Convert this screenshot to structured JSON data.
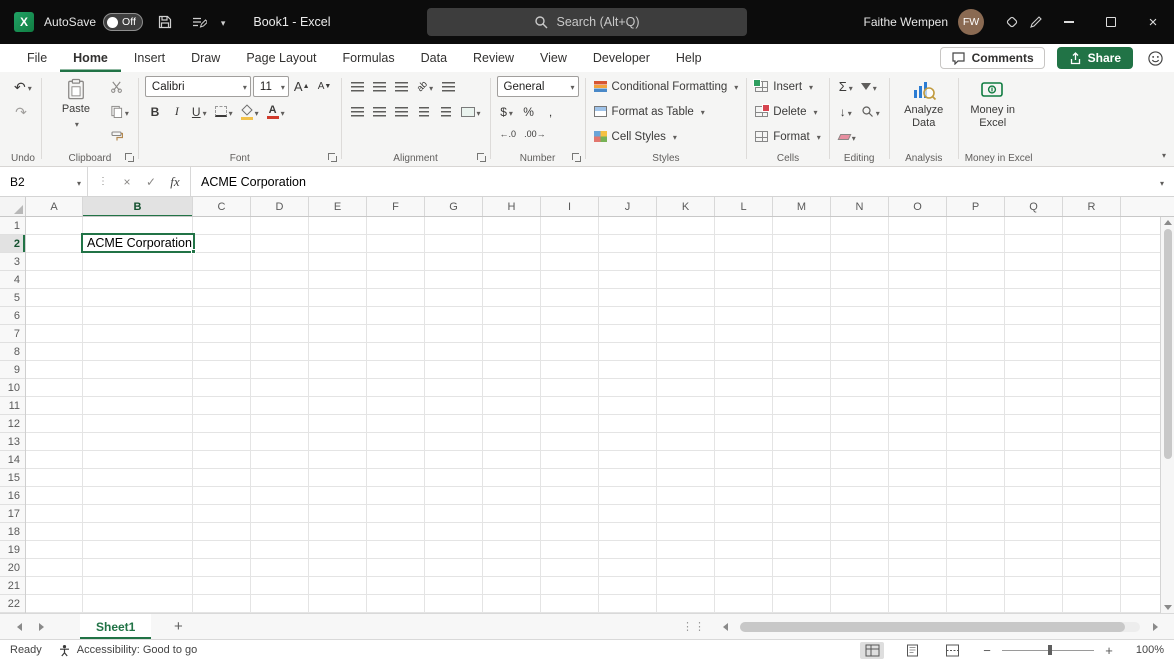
{
  "titlebar": {
    "autosave_label": "AutoSave",
    "autosave_state": "Off",
    "window_title": "Book1 - Excel",
    "search_placeholder": "Search (Alt+Q)",
    "user_name": "Faithe Wempen",
    "user_initials": "FW"
  },
  "tabs": [
    {
      "label": "File",
      "active": false
    },
    {
      "label": "Home",
      "active": true
    },
    {
      "label": "Insert",
      "active": false
    },
    {
      "label": "Draw",
      "active": false
    },
    {
      "label": "Page Layout",
      "active": false
    },
    {
      "label": "Formulas",
      "active": false
    },
    {
      "label": "Data",
      "active": false
    },
    {
      "label": "Review",
      "active": false
    },
    {
      "label": "View",
      "active": false
    },
    {
      "label": "Developer",
      "active": false
    },
    {
      "label": "Help",
      "active": false
    }
  ],
  "tab_actions": {
    "comments_label": "Comments",
    "share_label": "Share"
  },
  "ribbon": {
    "group_labels": [
      "Undo",
      "Clipboard",
      "Font",
      "Alignment",
      "Number",
      "Styles",
      "Cells",
      "Editing",
      "Analysis",
      "Money in Excel"
    ],
    "paste_label": "Paste",
    "font_name": "Calibri",
    "font_size": "11",
    "number_format": "General",
    "conditional_formatting_label": "Conditional Formatting",
    "format_as_table_label": "Format as Table",
    "cell_styles_label": "Cell Styles",
    "insert_label": "Insert",
    "delete_label": "Delete",
    "format_label": "Format",
    "analyze_data_label": "Analyze Data",
    "money_in_excel_label": "Money in Excel"
  },
  "glyphs": {
    "undo": "↶",
    "redo": "↷",
    "bold": "B",
    "italic": "I",
    "underline": "U",
    "font_grow": "A",
    "font_shrink": "A",
    "font_color": "A",
    "orientation": "ab",
    "sigma": "Σ",
    "dollar": "$",
    "percent": "%",
    "comma": ",",
    "increase_decimal": "←.0",
    "decrease_decimal": ".00→",
    "fill_down": "↓",
    "plus": "+",
    "minus": "−"
  },
  "formula_bar": {
    "name_box": "B2",
    "fx_label": "fx",
    "content": "ACME Corporation"
  },
  "grid": {
    "columns": [
      "A",
      "B",
      "C",
      "D",
      "E",
      "F",
      "G",
      "H",
      "I",
      "J",
      "K",
      "L",
      "M",
      "N",
      "O",
      "P",
      "Q",
      "R"
    ],
    "rows": [
      "1",
      "2",
      "3",
      "4",
      "5",
      "6",
      "7",
      "8",
      "9",
      "10",
      "11",
      "12",
      "13",
      "14",
      "15",
      "16",
      "17",
      "18",
      "19",
      "20",
      "21",
      "22"
    ],
    "selection": {
      "ref": "B2",
      "value": "ACME Corporation"
    }
  },
  "sheet_bar": {
    "active_tab": "Sheet1",
    "new_sheet": "+"
  },
  "status_bar": {
    "mode": "Ready",
    "accessibility": "Accessibility: Good to go",
    "zoom": "100%"
  },
  "colors": {
    "accent_green": "#217346",
    "titlebar_bg": "#0c0c0c",
    "ribbon_bg": "#f5f5f4",
    "selection_border": "#217346"
  }
}
